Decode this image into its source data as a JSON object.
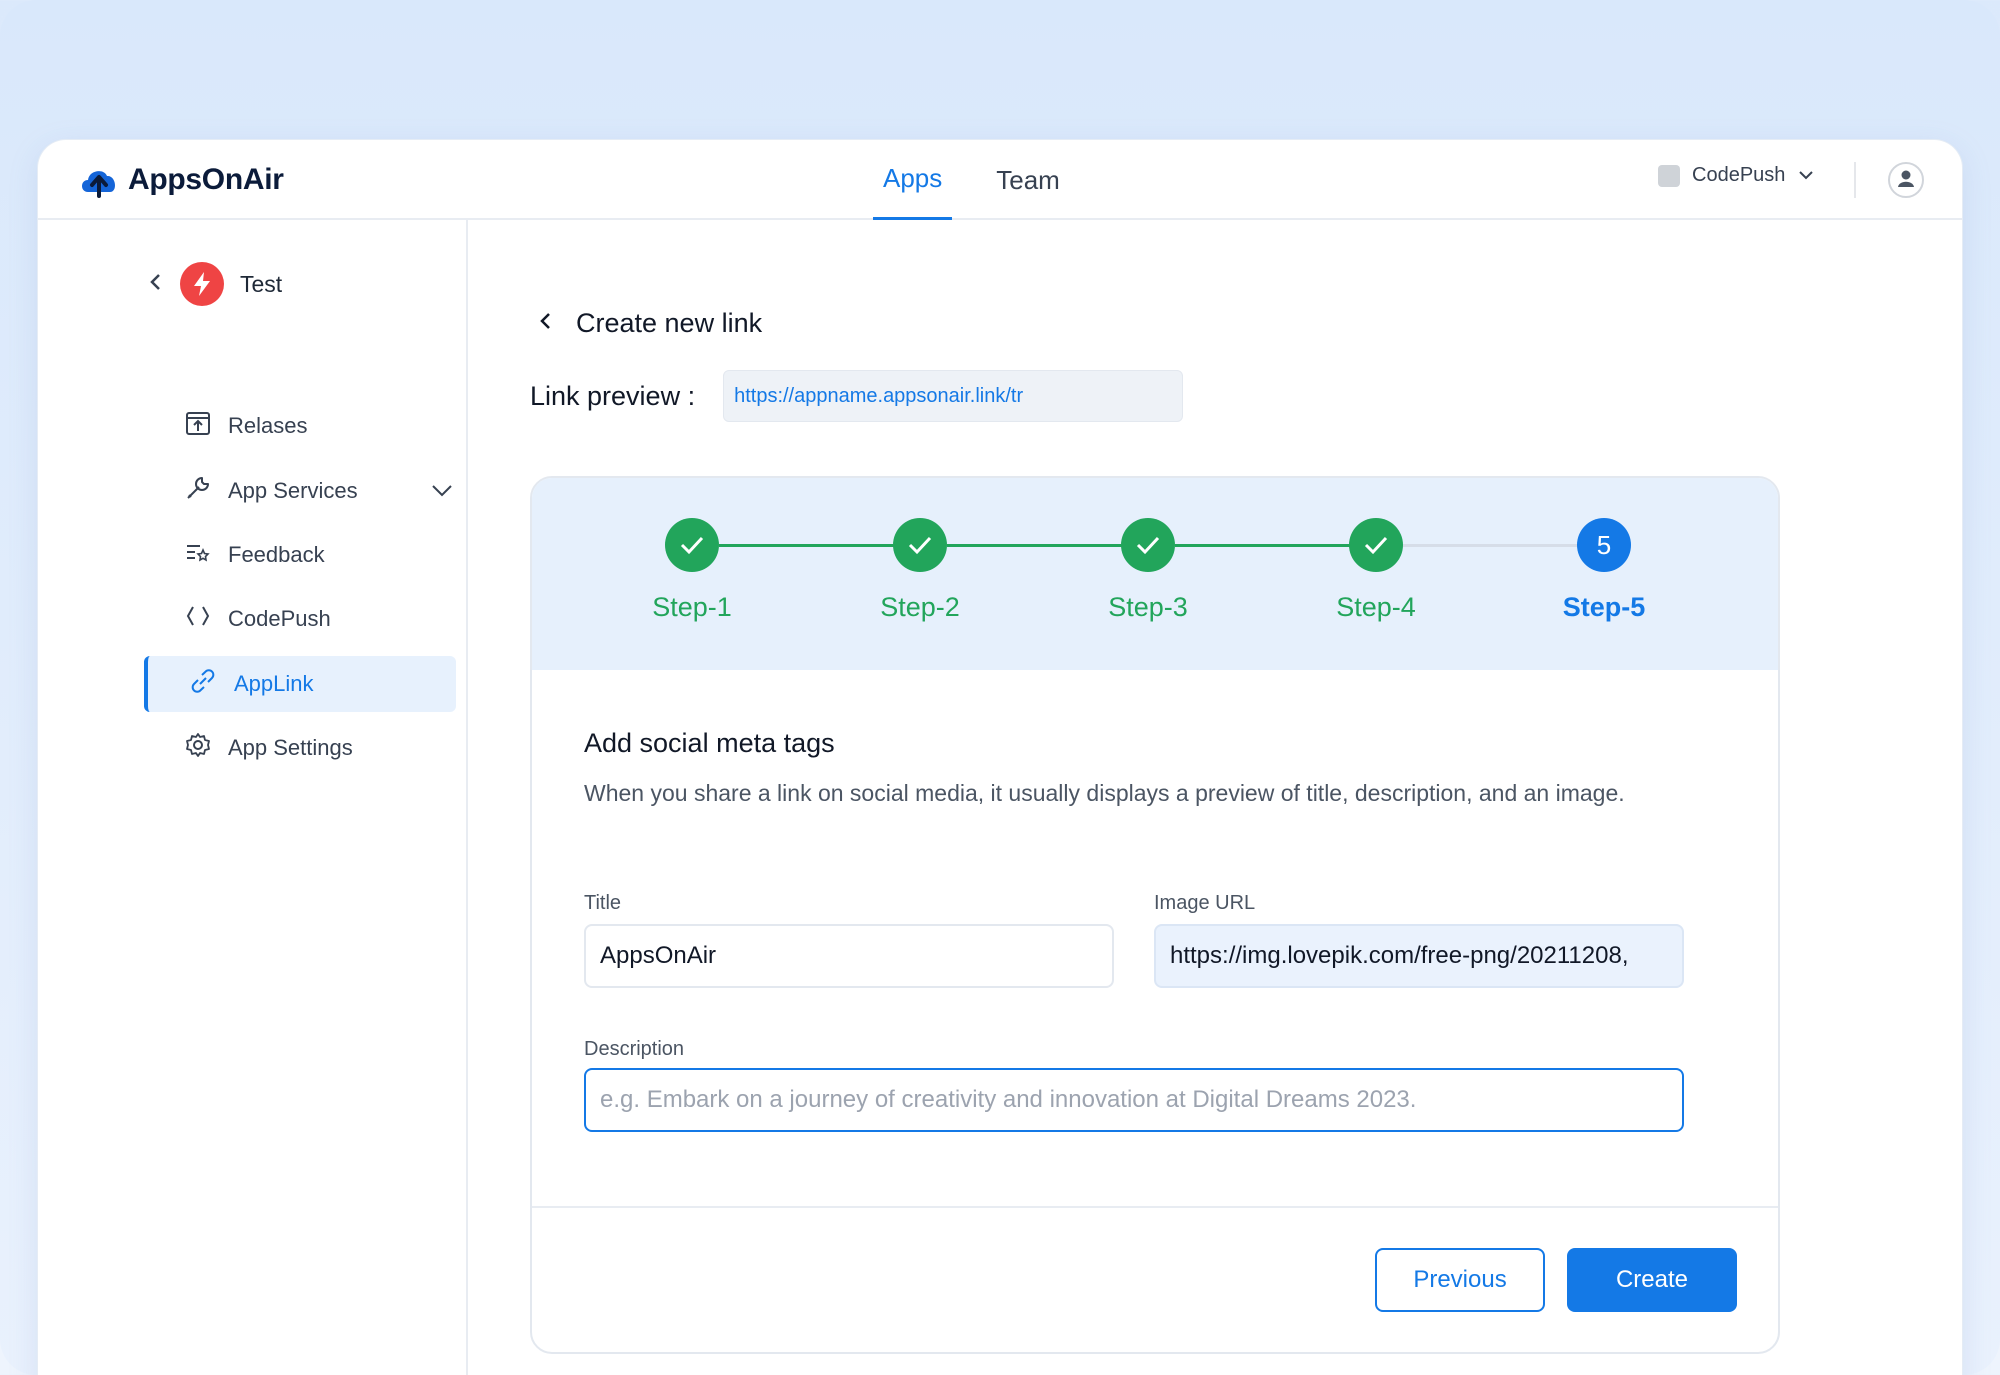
{
  "brand": {
    "name": "AppsOnAir"
  },
  "nav": {
    "apps": "Apps",
    "team": "Team"
  },
  "org": {
    "name": "CodePush"
  },
  "sidebar": {
    "app_name": "Test",
    "items": [
      {
        "label": "Relases"
      },
      {
        "label": "App Services"
      },
      {
        "label": "Feedback"
      },
      {
        "label": "CodePush"
      },
      {
        "label": "AppLink"
      },
      {
        "label": "App Settings"
      }
    ]
  },
  "page": {
    "back_title": "Create new link",
    "preview_label": "Link preview :",
    "preview_url": "https://appname.appsonair.link/tr"
  },
  "stepper": {
    "steps": [
      {
        "label": "Step-1",
        "state": "done"
      },
      {
        "label": "Step-2",
        "state": "done"
      },
      {
        "label": "Step-3",
        "state": "done"
      },
      {
        "label": "Step-4",
        "state": "done"
      },
      {
        "label": "Step-5",
        "number": "5",
        "state": "current"
      }
    ]
  },
  "form": {
    "section_title": "Add social meta tags",
    "section_desc": "When you share a link on social media, it usually displays a preview of title, description, and an image.",
    "title_label": "Title",
    "title_value": "AppsOnAir",
    "image_label": "Image URL",
    "image_value": "https://img.lovepik.com/free-png/20211208,",
    "desc_label": "Description",
    "desc_placeholder": "e.g. Embark on a journey of creativity and innovation at Digital Dreams 2023."
  },
  "actions": {
    "previous": "Previous",
    "create": "Create"
  },
  "colors": {
    "accent": "#1479e6",
    "success": "#22a55b",
    "danger": "#ef4444"
  }
}
